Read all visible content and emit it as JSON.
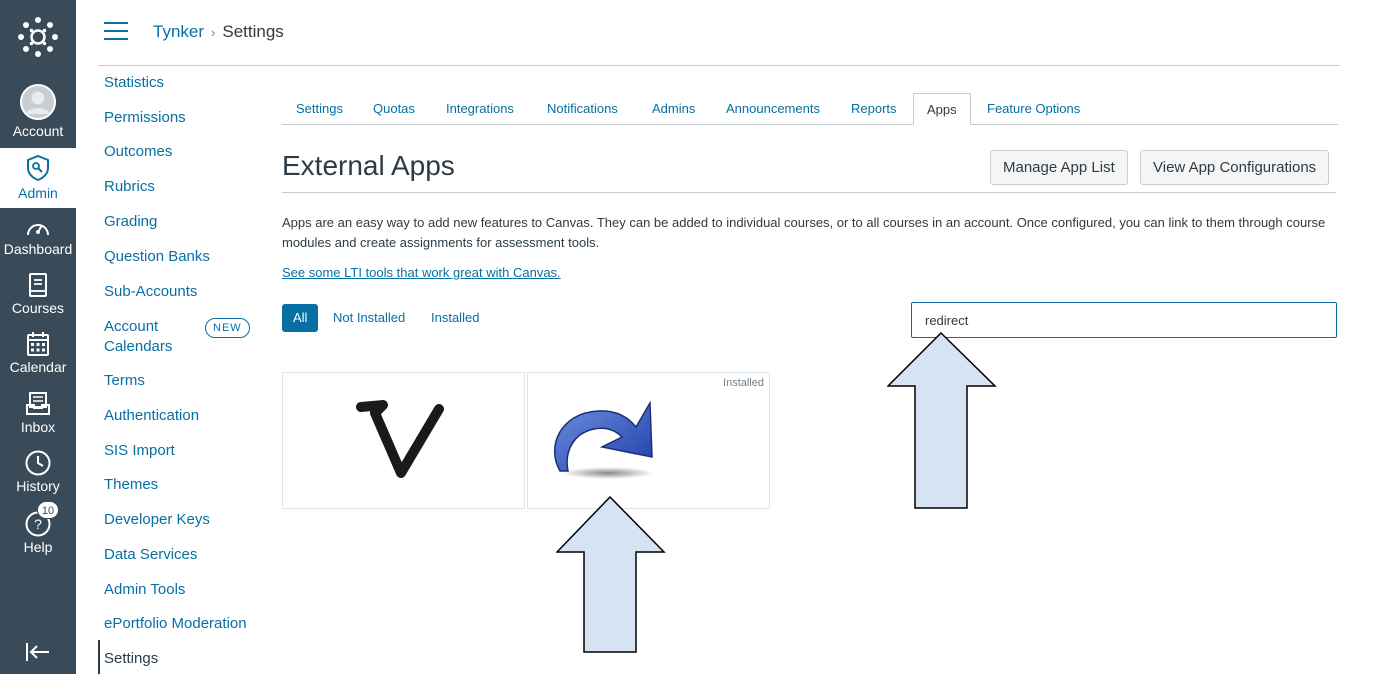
{
  "global_nav": {
    "account": "Account",
    "admin": "Admin",
    "dashboard": "Dashboard",
    "courses": "Courses",
    "calendar": "Calendar",
    "inbox": "Inbox",
    "history": "History",
    "help": "Help",
    "help_badge": "10"
  },
  "breadcrumb": {
    "account": "Tynker",
    "page": "Settings"
  },
  "left_menu": {
    "items": [
      "Statistics",
      "Permissions",
      "Outcomes",
      "Rubrics",
      "Grading",
      "Question Banks",
      "Sub-Accounts",
      "Account Calendars",
      "Terms",
      "Authentication",
      "SIS Import",
      "Themes",
      "Developer Keys",
      "Data Services",
      "Admin Tools",
      "ePortfolio Moderation",
      "Settings"
    ],
    "account_calendars_line1": "Account",
    "account_calendars_line2": "Calendars",
    "new_pill": "NEW",
    "active": "Settings"
  },
  "tabs": [
    "Settings",
    "Quotas",
    "Integrations",
    "Notifications",
    "Admins",
    "Announcements",
    "Reports",
    "Apps",
    "Feature Options"
  ],
  "active_tab": "Apps",
  "page": {
    "title": "External Apps",
    "manage_button": "Manage App List",
    "view_config_button": "View App Configurations",
    "description": "Apps are an easy way to add new features to Canvas. They can be added to individual courses, or to all courses in an account. Once configured, you can link to them through course modules and create assignments for assessment tools.",
    "lti_link": "See some LTI tools that work great with Canvas."
  },
  "filters": {
    "all": "All",
    "not_installed": "Not Installed",
    "installed": "Installed",
    "active": "All"
  },
  "search": {
    "value": "redirect"
  },
  "apps": [
    {
      "icon": "v-check-logo-icon",
      "installed_label": ""
    },
    {
      "icon": "redirect-arrow-icon",
      "installed_label": "Installed"
    }
  ],
  "colors": {
    "nav_bg": "#394b58",
    "link": "#0770a3",
    "arrow_fill": "#d6e3f2"
  }
}
